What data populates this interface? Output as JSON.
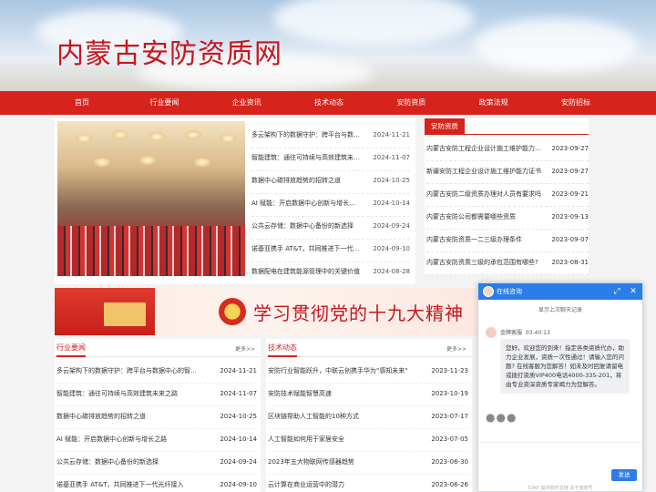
{
  "site": {
    "title": "内蒙古安防资质网"
  },
  "nav": [
    "首页",
    "行业要闻",
    "企业资讯",
    "技术动态",
    "安防资质",
    "政策法规",
    "安防招标"
  ],
  "featured": [
    {
      "title": "多云架构下的数据守护：跨平台与数据中心的智能管理",
      "date": "2024-11-21"
    },
    {
      "title": "智能建筑：通往可持续与高效建筑未来之路",
      "date": "2024-11-07"
    },
    {
      "title": "数据中心碳排放趋势的招转之道",
      "date": "2024-10-25"
    },
    {
      "title": "AI 赋能：开启数据中心创新与增长之路",
      "date": "2024-10-14"
    },
    {
      "title": "公共云存储：数据中心备份的新选择",
      "date": "2024-09-24"
    },
    {
      "title": "诺基亚携手 AT&T，共同推进下一代光纤接入",
      "date": "2024-09-10"
    },
    {
      "title": "数据配电在建筑能源管理中的关键价值",
      "date": "2024-08-28"
    }
  ],
  "zizhi": {
    "tab": "安防资质",
    "items": [
      {
        "title": "内蒙古安防工程企业设计施工维护能力评价",
        "date": "2023-09-27"
      },
      {
        "title": "新疆安防工程企业设计施工维护能力证书",
        "date": "2023-09-27"
      },
      {
        "title": "内蒙古安防二级资质办理对人员有要求吗",
        "date": "2023-09-21"
      },
      {
        "title": "内蒙古安防公司都需要哪些资质",
        "date": "2023-09-13"
      },
      {
        "title": "内蒙古安防资质一二三级办理条件",
        "date": "2023-09-07"
      },
      {
        "title": "内蒙古安防资质三级的承包范围有哪些?",
        "date": "2023-08-31"
      }
    ]
  },
  "banner": {
    "text": "学习贯彻党的十九大精神"
  },
  "industry": {
    "title": "行业要闻",
    "more": "更多>>",
    "items": [
      {
        "title": "多云架构下的数据守护：跨平台与数据中心的智能管理",
        "date": "2024-11-21"
      },
      {
        "title": "智能建筑：通往可持续与高效建筑未来之路",
        "date": "2024-11-07"
      },
      {
        "title": "数据中心碳排放趋势的招转之道",
        "date": "2024-10-25"
      },
      {
        "title": "AI 赋能：开启数据中心创新与增长之路",
        "date": "2024-10-14"
      },
      {
        "title": "公共云存储：数据中心备份的新选择",
        "date": "2024-09-24"
      },
      {
        "title": "诺基亚携手 AT&T，共同推进下一代光纤接入",
        "date": "2024-09-10"
      }
    ]
  },
  "tech": {
    "title": "技术动态",
    "more": "更多>>",
    "items": [
      {
        "title": "安防行业智能跃升，中联云创携手华为\"感知未来\"",
        "date": "2023-11-23"
      },
      {
        "title": "安防技术赋能智慧高速",
        "date": "2023-10-19"
      },
      {
        "title": "区块链帮助人工智能的10种方式",
        "date": "2023-07-17"
      },
      {
        "title": "人工智能如何用于家居安全",
        "date": "2023-07-05"
      },
      {
        "title": "2023年五大物联网传感器趋势",
        "date": "2023-06-30"
      },
      {
        "title": "云计算在商业运营中的潜力",
        "date": "2023-06-26"
      }
    ]
  },
  "chat": {
    "header": "在线咨询",
    "history": "显示上次聊天记录",
    "agent": "金牌客服",
    "time": "03:40:13",
    "message": "您好，欢迎您的到来！指定各类资质代办，助力企业发展，资质一次性通过！请输入您的问题? 在线客服为您解答！如未及时回复请留电或拨打资质VIP400电话4000-335-201，将由专业资深资质专家竭力为您解答。",
    "send": "发送",
    "footer": "53KF 提供软件支持  关于该账号"
  }
}
